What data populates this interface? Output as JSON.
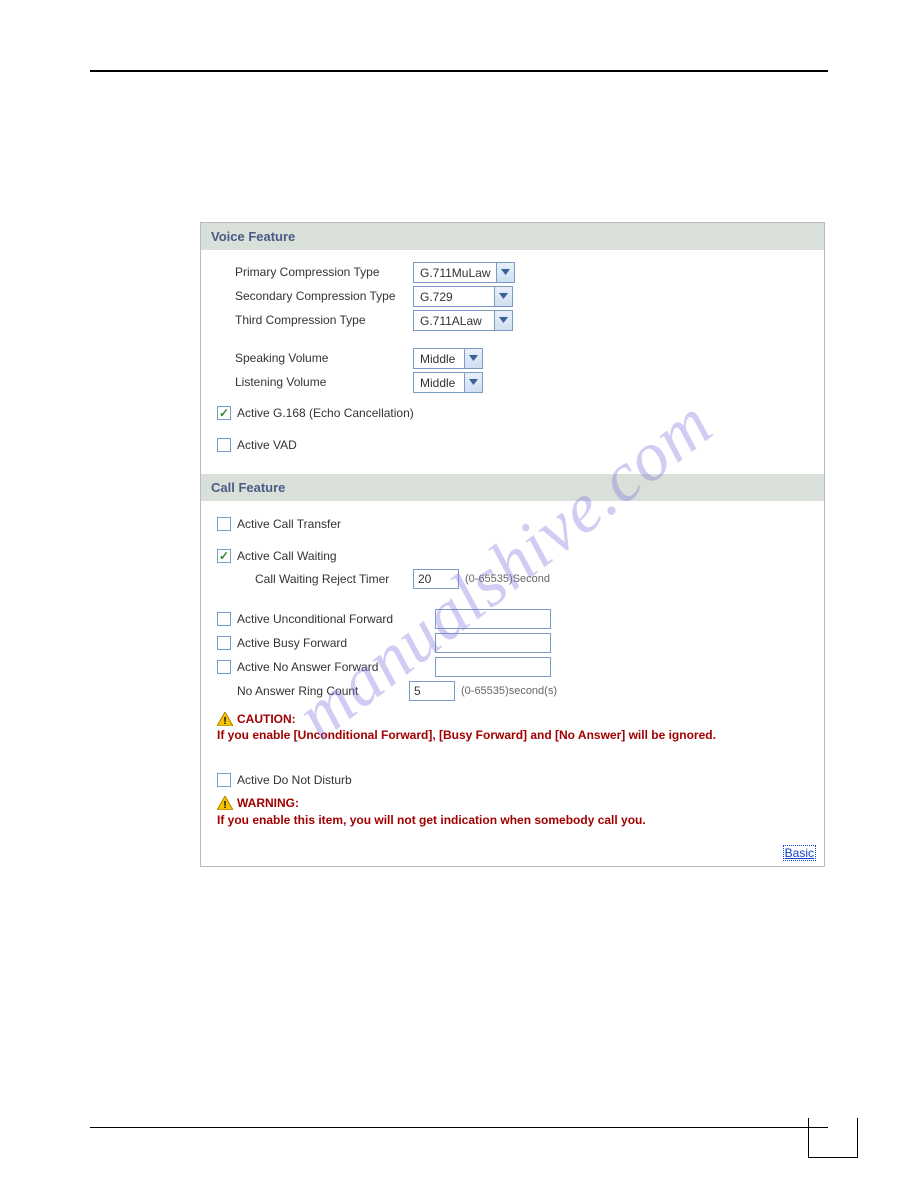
{
  "watermark": "manualshive.com",
  "voice": {
    "header": "Voice Feature",
    "primary_label": "Primary Compression Type",
    "primary_value": "G.711MuLaw",
    "secondary_label": "Secondary Compression Type",
    "secondary_value": "G.729",
    "third_label": "Third Compression Type",
    "third_value": "G.711ALaw",
    "speaking_label": "Speaking Volume",
    "speaking_value": "Middle",
    "listening_label": "Listening Volume",
    "listening_value": "Middle",
    "g168_label": "Active G.168 (Echo Cancellation)",
    "g168_checked": true,
    "vad_label": "Active VAD",
    "vad_checked": false
  },
  "call": {
    "header": "Call Feature",
    "call_transfer_label": "Active Call Transfer",
    "call_transfer_checked": false,
    "call_waiting_label": "Active Call Waiting",
    "call_waiting_checked": true,
    "reject_timer_label": "Call Waiting Reject Timer",
    "reject_timer_value": "20",
    "reject_timer_hint": "(0-65535)Second",
    "uncond_label": "Active Unconditional Forward",
    "uncond_checked": false,
    "uncond_value": "",
    "busy_label": "Active Busy Forward",
    "busy_checked": false,
    "busy_value": "",
    "noans_label": "Active No Answer Forward",
    "noans_checked": false,
    "noans_value": "",
    "ring_count_label": "No Answer Ring Count",
    "ring_count_value": "5",
    "ring_count_hint": "(0-65535)second(s)",
    "caution_title": "CAUTION:",
    "caution_text": "If you enable [Unconditional Forward], [Busy Forward] and [No Answer] will be ignored.",
    "dnd_label": "Active Do Not Disturb",
    "dnd_checked": false,
    "warning_title": "WARNING:",
    "warning_text": "If you enable this item, you will not get indication when somebody call you.",
    "basic_link": "Basic"
  }
}
